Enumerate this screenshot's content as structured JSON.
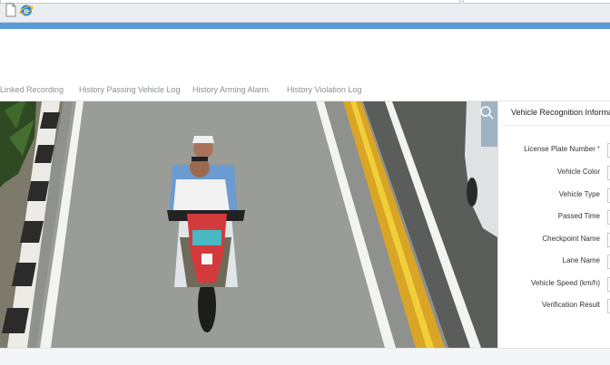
{
  "browser": {
    "tab_icons": [
      "blank-page-icon",
      "internet-explorer-icon"
    ],
    "accent_color": "#5b9bd5"
  },
  "nav": {
    "items": [
      {
        "label": "Linked Recording"
      },
      {
        "label": "History Passing Vehicle Log"
      },
      {
        "label": "History Arming Alarm"
      },
      {
        "label": "History Violation Log"
      }
    ]
  },
  "panel": {
    "title": "Vehicle Recognition Informa",
    "fields": [
      {
        "label": "License Plate Number",
        "required": "*"
      },
      {
        "label": "Vehicle Color"
      },
      {
        "label": "Vehicle Type"
      },
      {
        "label": "Passed Time"
      },
      {
        "label": "Checkpoint Name"
      },
      {
        "label": "Lane Name"
      },
      {
        "label": "Vehicle Speed (km/h)"
      },
      {
        "label": "Verification Result"
      }
    ]
  },
  "camera": {
    "zoom_icon": "magnifier-icon"
  }
}
